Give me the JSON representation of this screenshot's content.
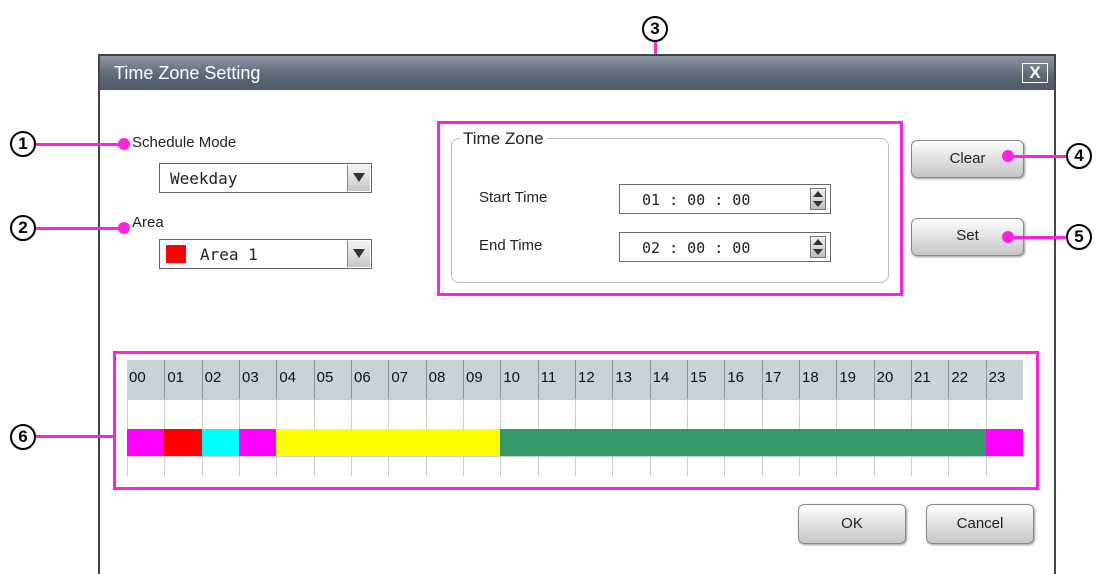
{
  "dialog": {
    "title": "Time Zone Setting",
    "close_label": "X"
  },
  "schedule_mode": {
    "label": "Schedule Mode",
    "value": "Weekday"
  },
  "area": {
    "label": "Area",
    "value": "Area 1",
    "swatch_color": "#ff0000"
  },
  "time_zone": {
    "legend": "Time Zone",
    "start_label": "Start Time",
    "start_value": "01 : 00 : 00",
    "end_label": "End Time",
    "end_value": "02 : 00 : 00"
  },
  "buttons": {
    "clear": "Clear",
    "set": "Set",
    "ok": "OK",
    "cancel": "Cancel"
  },
  "callouts": [
    "1",
    "2",
    "3",
    "4",
    "5",
    "6"
  ],
  "timeline": {
    "hours": [
      "00",
      "01",
      "02",
      "03",
      "04",
      "05",
      "06",
      "07",
      "08",
      "09",
      "10",
      "11",
      "12",
      "13",
      "14",
      "15",
      "16",
      "17",
      "18",
      "19",
      "20",
      "21",
      "22",
      "23"
    ],
    "segments": [
      {
        "from": 0,
        "to": 1,
        "color": "#ff00ff"
      },
      {
        "from": 1,
        "to": 2,
        "color": "#ff0000"
      },
      {
        "from": 2,
        "to": 3,
        "color": "#00ffff"
      },
      {
        "from": 3,
        "to": 4,
        "color": "#ff00ff"
      },
      {
        "from": 4,
        "to": 10,
        "color": "#ffff00"
      },
      {
        "from": 10,
        "to": 23,
        "color": "#339966"
      },
      {
        "from": 23,
        "to": 24,
        "color": "#ff00ff"
      }
    ]
  },
  "colors": {
    "highlight": "#ff22dd",
    "titlebar": "#5e6977"
  }
}
